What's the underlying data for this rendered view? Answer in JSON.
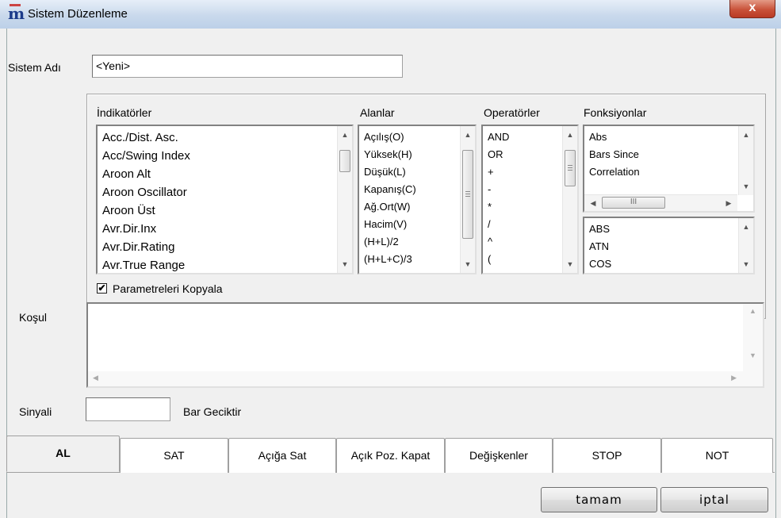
{
  "window": {
    "title": "Sistem Düzenleme",
    "close_symbol": "x"
  },
  "app_icon_glyph": "m",
  "sistem_adi": {
    "label": "Sistem Adı",
    "value": "<Yeni>"
  },
  "columns": {
    "indikatorler": {
      "header": "İndikatörler",
      "items": [
        "Acc./Dist. Asc.",
        "Acc/Swing Index",
        "Aroon Alt",
        "Aroon Oscillator",
        "Aroon Üst",
        "Avr.Dir.Inx",
        "Avr.Dir.Rating",
        "Avr.True Range"
      ]
    },
    "alanlar": {
      "header": "Alanlar",
      "items": [
        "Açılış(O)",
        "Yüksek(H)",
        "Düşük(L)",
        "Kapanış(C)",
        "Ağ.Ort(W)",
        "Hacim(V)",
        "(H+L)/2",
        "(H+L+C)/3"
      ]
    },
    "operatorler": {
      "header": "Operatörler",
      "items": [
        "AND",
        "OR",
        "+",
        "-",
        "*",
        "/",
        "^",
        "("
      ]
    },
    "fonksiyonlar": {
      "header": "Fonksiyonlar",
      "items": [
        "Abs",
        "Bars Since",
        "Correlation"
      ],
      "items2": [
        "ABS",
        "ATN",
        "COS"
      ]
    }
  },
  "copy_params": {
    "label": "Parametreleri Kopyala",
    "checked": true,
    "mark": "✔"
  },
  "kosul": {
    "label": "Koşul",
    "value": ""
  },
  "sinyali": {
    "label": "Sinyali",
    "value": "",
    "suffix": "Bar Geciktir"
  },
  "tabs": [
    "AL",
    "SAT",
    "Açığa Sat",
    "Açık Poz. Kapat",
    "Değişkenler",
    "STOP",
    "NOT"
  ],
  "active_tab": "AL",
  "buttons": {
    "ok": "tamam",
    "cancel": "iptal"
  },
  "scroll_glyphs": {
    "up": "▲",
    "down": "▼",
    "left": "◀",
    "right": "▶",
    "grip": "III"
  }
}
